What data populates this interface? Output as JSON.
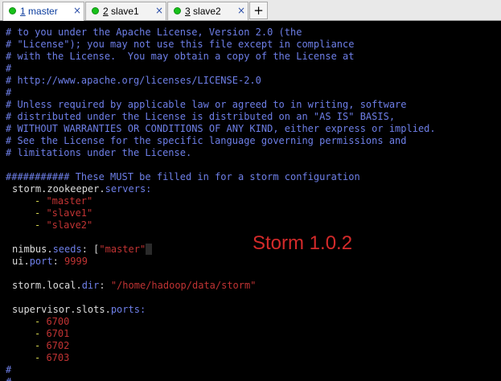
{
  "tabs": [
    {
      "number": "1",
      "name": "master",
      "close": "×"
    },
    {
      "number": "2",
      "name": "slave1",
      "close": "×"
    },
    {
      "number": "3",
      "name": "slave2",
      "close": "×"
    }
  ],
  "new_tab_label": "+",
  "editor": {
    "lic1": "# to you under the Apache License, Version 2.0 (the",
    "lic2": "# \"License\"); you may not use this file except in compliance",
    "lic3": "# with the License.  You may obtain a copy of the License at",
    "lic4": "#",
    "lic5": "# http://www.apache.org/licenses/LICENSE-2.0",
    "lic6": "#",
    "lic7": "# Unless required by applicable law or agreed to in writing, software",
    "lic8": "# distributed under the License is distributed on an \"AS IS\" BASIS,",
    "lic9": "# WITHOUT WARRANTIES OR CONDITIONS OF ANY KIND, either express or implied.",
    "lic10": "# See the License for the specific language governing permissions and",
    "lic11": "# limitations under the License.",
    "header": "########### These MUST be filled in for a storm configuration",
    "zk_key_a": "storm.zookeeper.",
    "zk_key_b": "servers",
    "zk_colon": ":",
    "dash": "- ",
    "zk_servers": [
      "\"master\"",
      "\"slave1\"",
      "\"slave2\""
    ],
    "nimbus_key_a": "nimbus.",
    "nimbus_key_b": "seeds",
    "colon": ": ",
    "bracket_open": "[",
    "nimbus_value": "\"master\"",
    "ui_key_a": "ui.",
    "ui_key_b": "port",
    "ui_port": "9999",
    "local_key_a": "storm.local.",
    "local_key_b": "dir",
    "local_dir": "\"/home/hadoop/data/storm\"",
    "sup_key_a": "supervisor.slots.",
    "sup_key_b": "ports",
    "ports": [
      "6700",
      "6701",
      "6702",
      "6703"
    ],
    "tail1": "#",
    "tail2": "#"
  },
  "overlay_title": "Storm 1.0.2",
  "colors": {
    "background": "#000000",
    "comment": "#6e7fe8",
    "string": "#c03333",
    "dash": "#d8d850",
    "overlay": "#d42a2a",
    "active_tab_dot": "#17c11a"
  }
}
